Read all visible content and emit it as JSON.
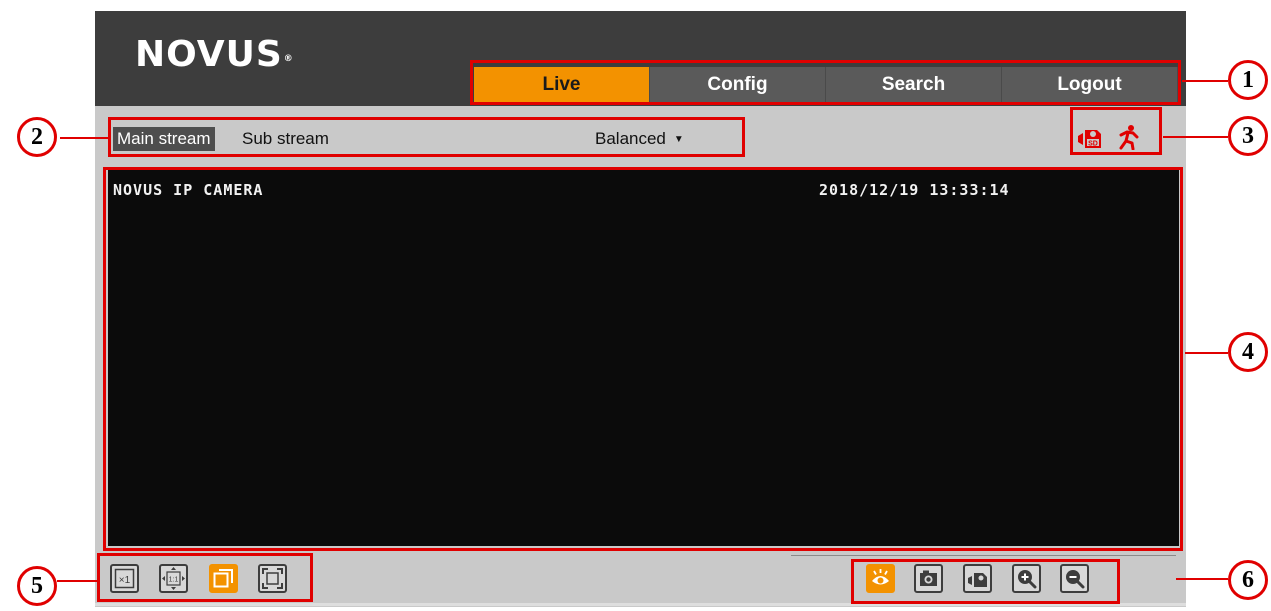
{
  "brand": {
    "logo_text": "NOVUS",
    "registered": "®"
  },
  "nav": {
    "items": [
      {
        "label": "Live",
        "active": true
      },
      {
        "label": "Config",
        "active": false
      },
      {
        "label": "Search",
        "active": false
      },
      {
        "label": "Logout",
        "active": false
      }
    ]
  },
  "streams": {
    "main_label": "Main stream",
    "sub_label": "Sub stream",
    "selected": "Main stream"
  },
  "quality": {
    "value": "Balanced"
  },
  "status_icons": [
    "sd-card-record-icon",
    "motion-detection-icon"
  ],
  "video": {
    "osd_title": "NOVUS IP CAMERA",
    "osd_timestamp": "2018/12/19 13:33:14"
  },
  "view_controls": [
    "original-size-icon",
    "fit-aspect-ratio-icon",
    "stretch-view-icon",
    "fullscreen-icon"
  ],
  "live_controls": [
    "live-view-icon",
    "snapshot-icon",
    "record-icon",
    "zoom-in-icon",
    "zoom-out-icon"
  ],
  "callouts": {
    "labels": [
      "1",
      "2",
      "3",
      "4",
      "5",
      "6"
    ]
  },
  "colors": {
    "accent": "#f39200",
    "header": "#3d3d3d",
    "annotation": "#e00000",
    "panel": "#c9c9c9"
  }
}
